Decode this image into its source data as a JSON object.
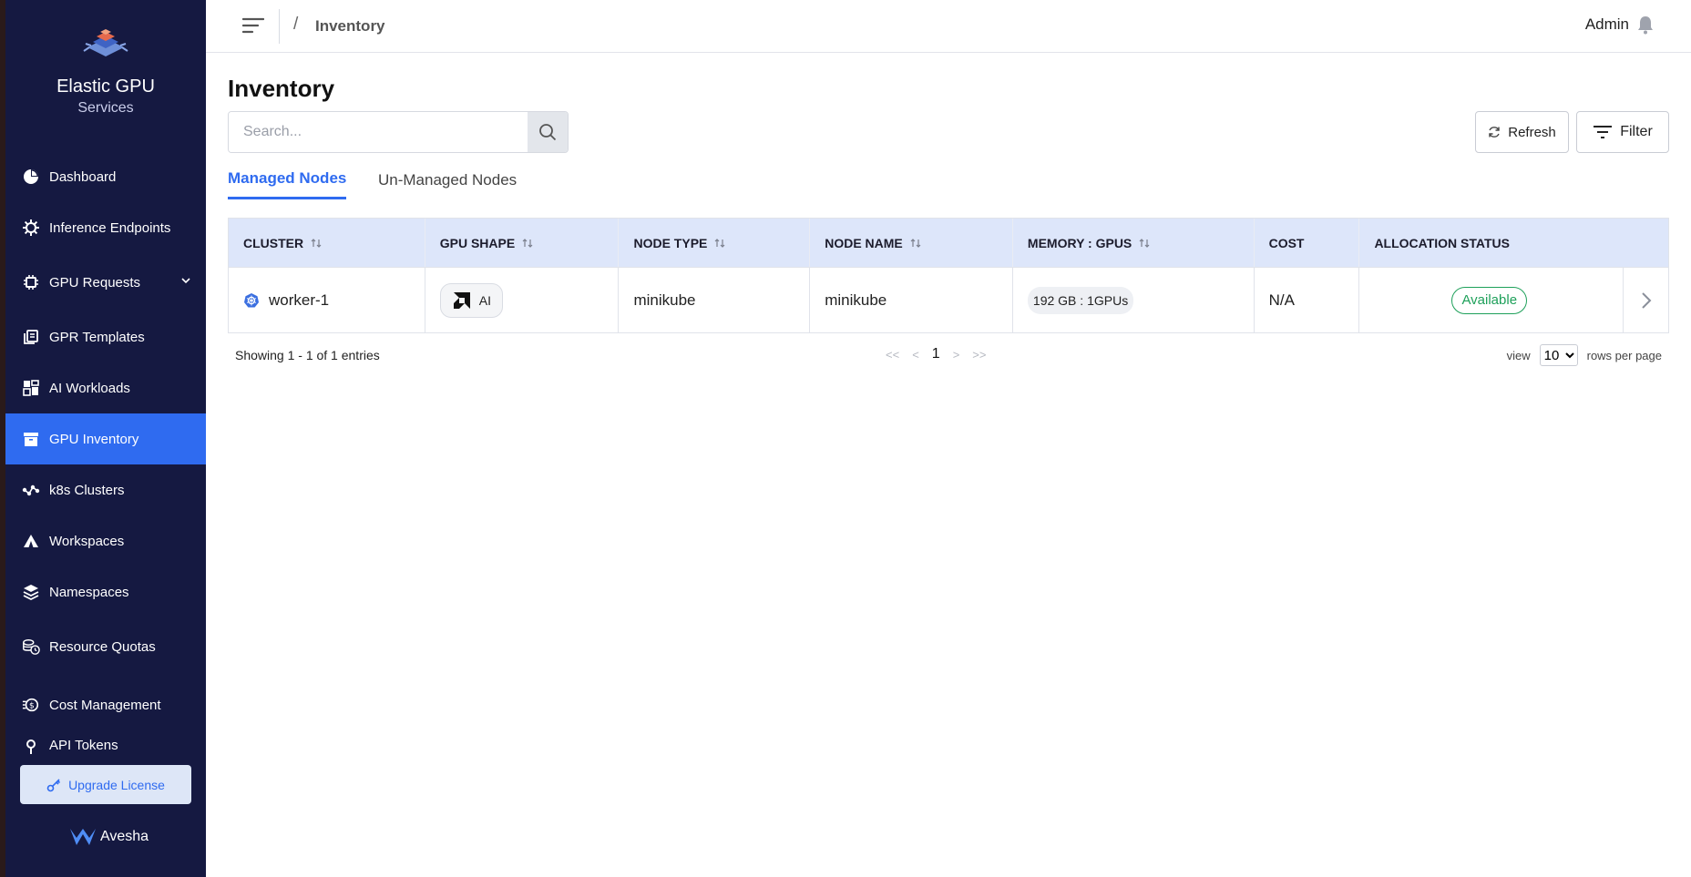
{
  "brand": {
    "title": "Elastic GPU",
    "subtitle": "Services"
  },
  "sidebar": {
    "items": [
      {
        "label": "Dashboard",
        "icon": "pie-chart-icon"
      },
      {
        "label": "Inference Endpoints",
        "icon": "gear-icon"
      },
      {
        "label": "GPU Requests",
        "icon": "chip-icon"
      },
      {
        "label": "GPR Templates",
        "icon": "copy-icon"
      },
      {
        "label": "AI Workloads",
        "icon": "grid-icon"
      },
      {
        "label": "GPU Inventory",
        "icon": "archive-icon"
      },
      {
        "label": "k8s Clusters",
        "icon": "nodes-icon"
      },
      {
        "label": "Workspaces",
        "icon": "tent-icon"
      },
      {
        "label": "Namespaces",
        "icon": "layers-icon"
      },
      {
        "label": "Resource Quotas",
        "icon": "coins-icon"
      },
      {
        "label": "Cost Management",
        "icon": "money-icon"
      },
      {
        "label": "API Tokens",
        "icon": "key-icon"
      }
    ],
    "active_item": "GPU Inventory",
    "upgrade_label": "Upgrade License",
    "footer_brand": "Avesha"
  },
  "header": {
    "breadcrumb": "Inventory",
    "breadcrumb_separator": "/",
    "user": "Admin"
  },
  "main": {
    "title": "Inventory",
    "search_placeholder": "Search...",
    "refresh_label": "Refresh",
    "filter_label": "Filter",
    "tabs": [
      {
        "label": "Managed Nodes",
        "active": true
      },
      {
        "label": "Un-Managed Nodes",
        "active": false
      }
    ],
    "table": {
      "columns": [
        "CLUSTER",
        "GPU SHAPE",
        "NODE TYPE",
        "NODE NAME",
        "MEMORY : GPUS",
        "COST",
        "ALLOCATION STATUS"
      ],
      "rows": [
        {
          "cluster": "worker-1",
          "gpu_shape": "AI",
          "node_type": "minikube",
          "node_name": "minikube",
          "memory_gpus": "192 GB : 1GPUs",
          "cost": "N/A",
          "allocation_status": "Available"
        }
      ]
    },
    "pagination": {
      "entries_text": "Showing 1 - 1 of 1 entries",
      "first": "<<",
      "prev": "<",
      "current_page": "1",
      "next": ">",
      "last": ">>",
      "view_label": "view",
      "rows_per_page": "10",
      "rows_per_page_label": "rows per page"
    }
  },
  "colors": {
    "sidebar_bg": "#151941",
    "accent": "#2f6bf0",
    "table_header_bg": "#dde6fa",
    "status_available": "#1ea05a"
  }
}
